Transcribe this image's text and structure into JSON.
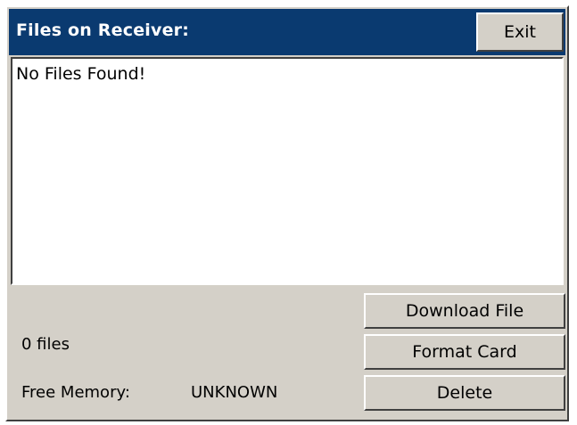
{
  "window": {
    "title": "Files on Receiver:",
    "exit_label": "Exit"
  },
  "file_list": {
    "empty_message": "No Files Found!",
    "items": []
  },
  "status": {
    "file_count": "0 files",
    "free_memory_label": "Free Memory:",
    "free_memory_value": "UNKNOWN"
  },
  "actions": {
    "download_label": "Download File",
    "format_label": "Format Card",
    "delete_label": "Delete"
  },
  "colors": {
    "titlebar": "#0a3a70",
    "panel": "#d4d0c8",
    "list_background": "#ffffff"
  }
}
